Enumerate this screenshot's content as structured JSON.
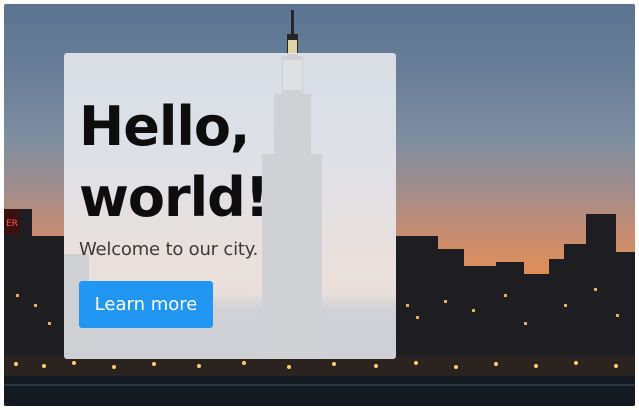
{
  "hero": {
    "title_line1": "Hello,",
    "title_line2": "world!",
    "subtitle": "Welcome to our city.",
    "cta_label": "Learn more"
  },
  "colors": {
    "cta_background": "#2196f3",
    "cta_text": "#ffffff",
    "panel_background": "#eceef2",
    "title_text": "#0d0d0d",
    "subtitle_text": "#3a3a3a"
  }
}
